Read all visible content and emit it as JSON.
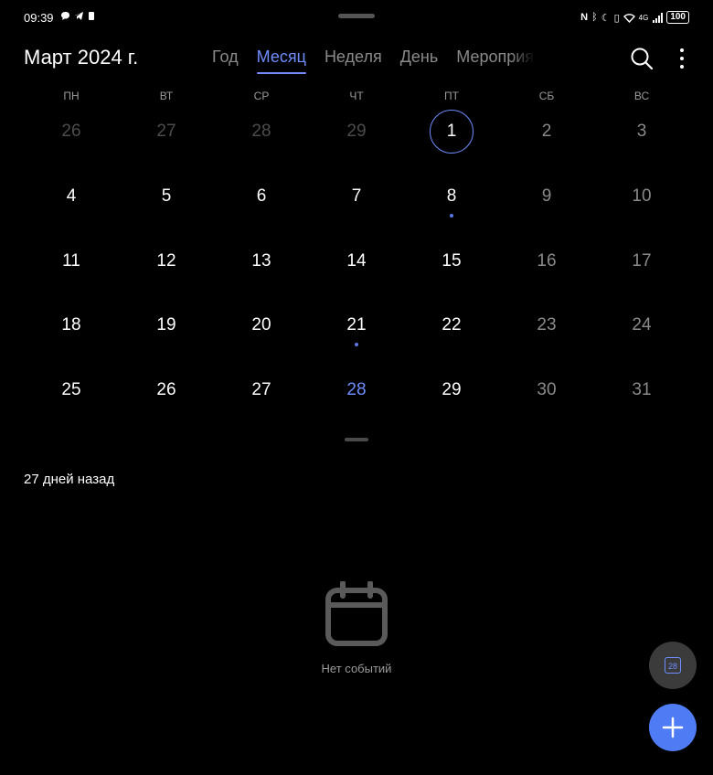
{
  "status_bar": {
    "time": "09:39",
    "battery": "100",
    "signal_label": "4G"
  },
  "header": {
    "title": "Март 2024 г.",
    "tabs": [
      {
        "label": "Год"
      },
      {
        "label": "Месяц",
        "active": true
      },
      {
        "label": "Неделя"
      },
      {
        "label": "День"
      },
      {
        "label": "Мероприя"
      }
    ],
    "icons": [
      "search-icon",
      "more-vert-icon"
    ]
  },
  "weekdays": [
    "ПН",
    "ВТ",
    "СР",
    "ЧТ",
    "ПТ",
    "СБ",
    "ВС"
  ],
  "weeks": [
    [
      "26",
      "27",
      "28",
      "29",
      "1",
      "2",
      "3"
    ],
    [
      "4",
      "5",
      "6",
      "7",
      "8",
      "9",
      "10"
    ],
    [
      "11",
      "12",
      "13",
      "14",
      "15",
      "16",
      "17"
    ],
    [
      "18",
      "19",
      "20",
      "21",
      "22",
      "23",
      "24"
    ],
    [
      "25",
      "26",
      "27",
      "28",
      "29",
      "30",
      "31"
    ]
  ],
  "events": [
    "8",
    "21"
  ],
  "selected_day": "1",
  "today": "28",
  "agenda": {
    "relative_label": "27 дней назад",
    "empty_text": "Нет событий"
  },
  "fab": {
    "today_label": "28"
  },
  "colors": {
    "accent": "#6f8dff",
    "fab": "#4f7cf5",
    "background": "#000000"
  }
}
